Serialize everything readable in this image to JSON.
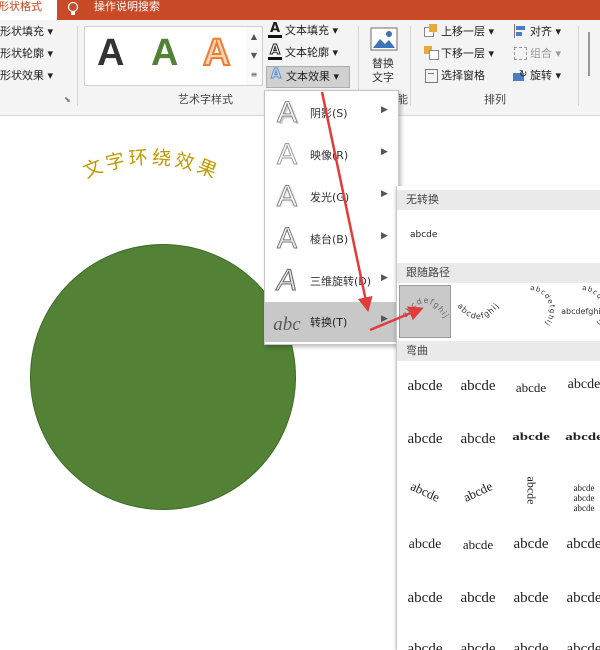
{
  "window": {
    "active_tab": "形状格式",
    "search_tab": "操作说明搜索"
  },
  "ribbon": {
    "shape_styles": {
      "fill": "形状填充",
      "outline": "形状轮廓",
      "effects": "形状效果"
    },
    "wordart_styles": {
      "group_label": "艺术字样式",
      "samples": [
        "A",
        "A",
        "A"
      ],
      "sample_colors": [
        "#111111",
        "#548235",
        "#ed7d31"
      ],
      "text_fill": "文本填充",
      "text_outline": "文本轮廓",
      "text_effects": "文本效果"
    },
    "alt_text": {
      "line1": "替换",
      "line2": "文字",
      "group_tail": "能"
    },
    "arrange": {
      "group_label": "排列",
      "bring_forward": "上移一层",
      "send_backward": "下移一层",
      "selection_pane": "选择窗格",
      "align": "对齐",
      "group": "组合",
      "rotate": "旋转"
    }
  },
  "effects_menu": {
    "items": [
      {
        "label": "阴影(S)",
        "letter": "A"
      },
      {
        "label": "映像(R)",
        "letter": "A"
      },
      {
        "label": "发光(G)",
        "letter": "A"
      },
      {
        "label": "棱台(B)",
        "letter": "A"
      },
      {
        "label": "三维旋转(D)",
        "letter": "A"
      },
      {
        "label": "转换(T)",
        "letter": "abc"
      }
    ]
  },
  "transform_submenu": {
    "no_transform": {
      "header": "无转换",
      "sample": "abcde"
    },
    "follow_path": {
      "header": "跟随路径",
      "sample": "abcdefghij"
    },
    "warp": {
      "header": "弯曲",
      "sample": "abcde"
    }
  },
  "canvas": {
    "wordart_text": "文字环绕效果",
    "circle_color": "#538135",
    "wordart_color": "#c09a00"
  },
  "colors": {
    "accent": "#c94a26",
    "arrow": "#e23b3b"
  }
}
